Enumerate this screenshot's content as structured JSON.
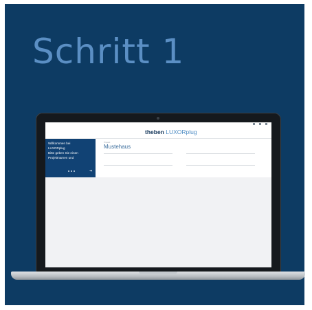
{
  "slide": {
    "title": "Schritt 1",
    "background_color": "#0d3b63",
    "title_color": "#5b8fc4"
  },
  "app": {
    "brand": "theben",
    "product": "LUXORplug",
    "window_controls": [
      "minimize-icon",
      "maximize-icon",
      "close-icon"
    ]
  },
  "welcome_panel": {
    "lines": [
      "Willkommen bei",
      "LUXORplug",
      "Bitte geben Sie einen",
      "Projektnamen und"
    ],
    "page_dots": 3,
    "next_icon": "arrow-right-icon"
  },
  "project_form": {
    "project_label": "Projekt",
    "project_name": "Mustehaus"
  }
}
